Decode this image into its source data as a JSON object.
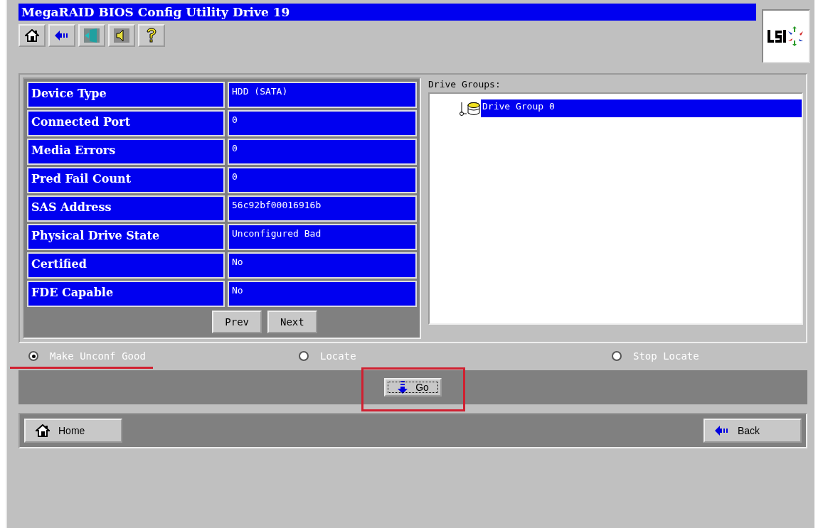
{
  "window": {
    "title": "MegaRAID BIOS Config Utility Drive 19"
  },
  "toolbar": [
    {
      "kind": "home"
    },
    {
      "kind": "back"
    },
    {
      "kind": "exit"
    },
    {
      "kind": "sound"
    },
    {
      "kind": "help"
    }
  ],
  "properties": [
    {
      "label": "Device Type",
      "value": "HDD (SATA)"
    },
    {
      "label": "Connected Port",
      "value": "0"
    },
    {
      "label": "Media Errors",
      "value": "0"
    },
    {
      "label": "Pred Fail Count",
      "value": "0"
    },
    {
      "label": "SAS Address",
      "value": "56c92bf00016916b"
    },
    {
      "label": "Physical Drive State",
      "value": "Unconfigured Bad"
    },
    {
      "label": "Certified",
      "value": "No"
    },
    {
      "label": "FDE Capable",
      "value": "No"
    }
  ],
  "pager": [
    {
      "label": "Prev"
    },
    {
      "label": "Next"
    }
  ],
  "drive_groups": {
    "title": "Drive Groups:",
    "items": [
      {
        "label": "Drive Group 0",
        "selected": true
      }
    ]
  },
  "actions": [
    {
      "label": "Make Unconf Good",
      "selected": true
    },
    {
      "label": "Locate",
      "selected": false
    },
    {
      "label": "Stop Locate",
      "selected": false
    }
  ],
  "go_button": {
    "label": "Go"
  },
  "nav": [
    {
      "kind": "home",
      "label": "Home"
    },
    {
      "kind": "back",
      "label": "Back"
    }
  ]
}
